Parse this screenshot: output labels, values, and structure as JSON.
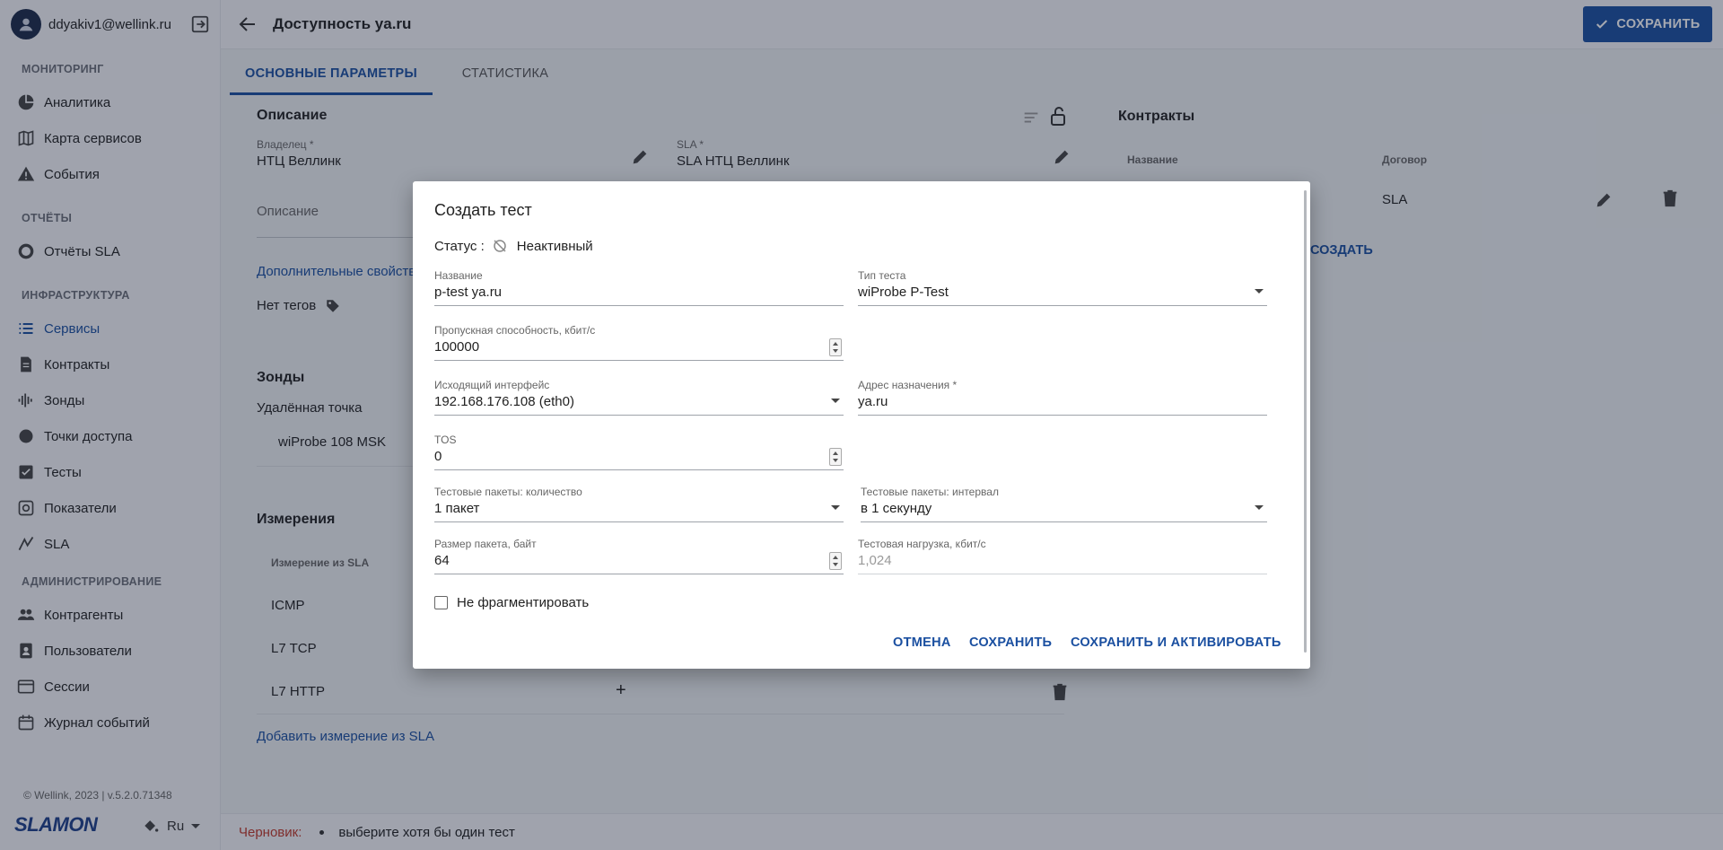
{
  "user": {
    "email": "ddyakiv1@wellink.ru"
  },
  "nav": {
    "monitoring_title": "МОНИТОРИНГ",
    "analytics": "Аналитика",
    "service_map": "Карта сервисов",
    "events": "События",
    "reports_title": "ОТЧЁТЫ",
    "sla_reports": "Отчёты SLA",
    "infra_title": "ИНФРАСТРУКТУРА",
    "services": "Сервисы",
    "contracts": "Контракты",
    "probes": "Зонды",
    "access_points": "Точки доступа",
    "tests": "Тесты",
    "metrics": "Показатели",
    "sla": "SLA",
    "admin_title": "АДМИНИСТРИРОВАНИЕ",
    "counterparties": "Контрагенты",
    "users": "Пользователи",
    "sessions": "Сессии",
    "event_log": "Журнал событий"
  },
  "footer": {
    "copyright": "© Wellink, 2023 | v.5.2.0.71348",
    "logo": "SLAMON",
    "lang": "Ru"
  },
  "header": {
    "title": "Доступность ya.ru",
    "save": "СОХРАНИТЬ"
  },
  "tabs": {
    "main": "ОСНОВНЫЕ ПАРАМЕТРЫ",
    "stats": "СТАТИСТИКА"
  },
  "page": {
    "description_title": "Описание",
    "owner_label": "Владелец *",
    "owner_value": "НТЦ Веллинк",
    "sla_label": "SLA *",
    "sla_value": "SLA НТЦ Веллинк",
    "description_placeholder": "Описание",
    "extra_props": "Дополнительные свойства",
    "no_tags": "Нет тегов",
    "contracts_title": "Контракты",
    "col_name": "Название",
    "col_contract": "Договор",
    "contract_value": "SLA",
    "create_link": "СОЗДАТЬ",
    "probes_title": "Зонды",
    "remote_point": "Удалённая точка",
    "probe_name": "wiProbe 108 MSK",
    "measurements_title": "Измерения",
    "col_measure": "Измерение из SLA",
    "m1": "ICMP",
    "m2": "L7 TCP",
    "m3": "L7 HTTP",
    "add_measure": "Добавить измерение из SLA"
  },
  "statusbar": {
    "draft": "Черновик:",
    "message": "выберите хотя бы один тест"
  },
  "dialog": {
    "title": "Создать тест",
    "status_label": "Статус :",
    "status_value": "Неактивный",
    "name_label": "Название",
    "name_value": "p-test ya.ru",
    "type_label": "Тип теста",
    "type_value": "wiProbe P-Test",
    "bandwidth_label": "Пропускная способность, кбит/с",
    "bandwidth_value": "100000",
    "iface_label": "Исходящий интерфейс",
    "iface_value": "192.168.176.108 (eth0)",
    "dest_label": "Адрес назначения *",
    "dest_value": "ya.ru",
    "tos_label": "TOS",
    "tos_value": "0",
    "pkt_count_label": "Тестовые пакеты: количество",
    "pkt_count_value": "1 пакет",
    "pkt_interval_label": "Тестовые пакеты: интервал",
    "pkt_interval_value": "в 1 секунду",
    "pkt_size_label": "Размер пакета, байт",
    "pkt_size_value": "64",
    "load_label": "Тестовая нагрузка, кбит/с",
    "load_value": "1,024",
    "nofrag": "Не фрагментировать",
    "cancel": "ОТМЕНА",
    "save": "СОХРАНИТЬ",
    "save_activate": "СОХРАНИТЬ И АКТИВИРОВАТЬ"
  }
}
